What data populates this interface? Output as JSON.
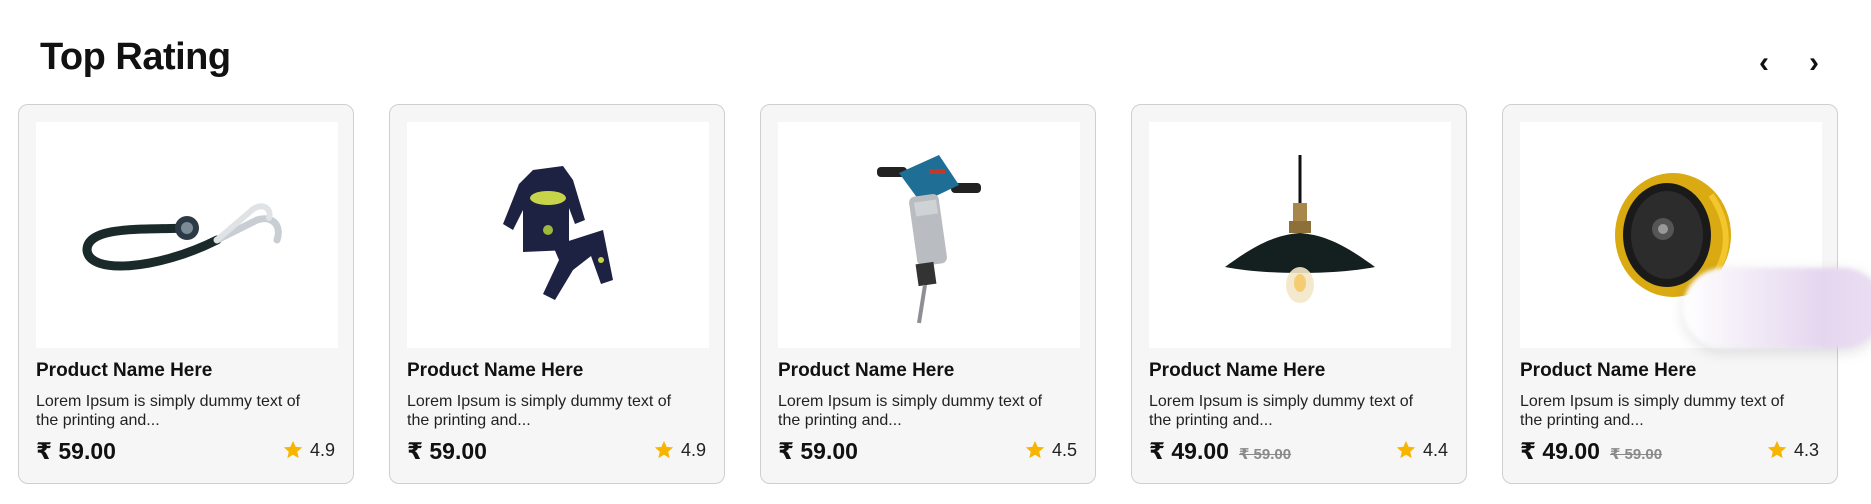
{
  "section": {
    "title": "Top Rating"
  },
  "nav": {
    "prev": "‹",
    "next": "›"
  },
  "colors": {
    "star": "#F7B500",
    "card_bg": "#F6F6F6"
  },
  "products": [
    {
      "image_icon": "stethoscope-icon",
      "name": "Product Name Here",
      "description": "Lorem Ipsum is simply dummy text of the printing and...",
      "price": "₹ 59.00",
      "old_price": "",
      "rating": "4.9"
    },
    {
      "image_icon": "kids-outfit-icon",
      "name": "Product Name Here",
      "description": "Lorem Ipsum is simply dummy text of the printing and...",
      "price": "₹ 59.00",
      "old_price": "",
      "rating": "4.9"
    },
    {
      "image_icon": "jackhammer-icon",
      "name": "Product Name Here",
      "description": "Lorem Ipsum is simply dummy text of the printing and...",
      "price": "₹ 59.00",
      "old_price": "",
      "rating": "4.5"
    },
    {
      "image_icon": "pendant-lamp-icon",
      "name": "Product Name Here",
      "description": "Lorem Ipsum is simply dummy text of the printing and...",
      "price": "₹ 49.00",
      "old_price": "₹ 59.00",
      "rating": "4.4"
    },
    {
      "image_icon": "speaker-icon",
      "name": "Product Name Here",
      "description": "Lorem Ipsum is simply dummy text of the printing and...",
      "price": "₹ 49.00",
      "old_price": "₹ 59.00",
      "rating": "4.3"
    }
  ]
}
